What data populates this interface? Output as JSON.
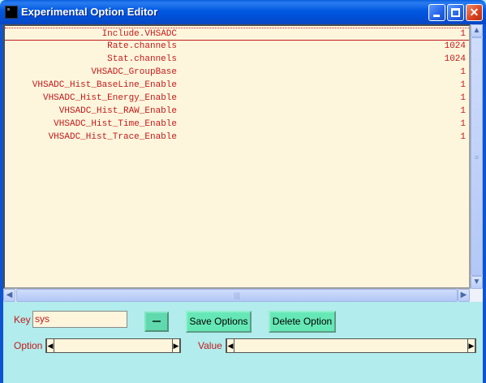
{
  "window": {
    "title": "Experimental Option Editor"
  },
  "options": [
    {
      "key": "Include.VHSADC",
      "value": "1"
    },
    {
      "key": "Rate.channels",
      "value": "1024"
    },
    {
      "key": "Stat.channels",
      "value": "1024"
    },
    {
      "key": "VHSADC_GroupBase",
      "value": "1"
    },
    {
      "key": "VHSADC_Hist_BaseLine_Enable",
      "value": "1"
    },
    {
      "key": "VHSADC_Hist_Energy_Enable",
      "value": "1"
    },
    {
      "key": "VHSADC_Hist_RAW_Enable",
      "value": "1"
    },
    {
      "key": "VHSADC_Hist_Time_Enable",
      "value": "1"
    },
    {
      "key": "VHSADC_Hist_Trace_Enable",
      "value": "1"
    }
  ],
  "form": {
    "key_label": "Key",
    "key_value": "sys",
    "save_label": "Save Options",
    "delete_label": "Delete Option",
    "option_label": "Option",
    "value_label": "Value"
  },
  "colors": {
    "text_red": "#c41a1a",
    "list_bg": "#fdf6dd",
    "panel_bg": "#b2ecec",
    "button_green": "#66e8b6"
  }
}
